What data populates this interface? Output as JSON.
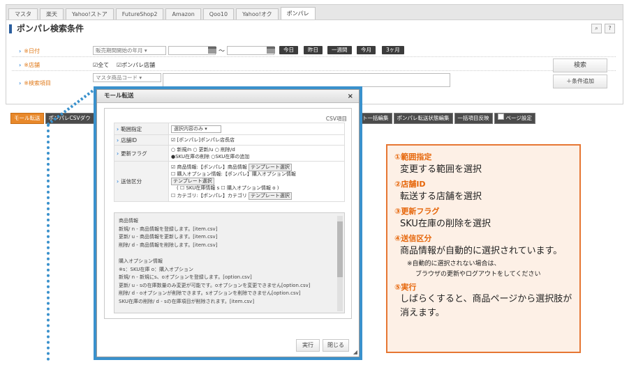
{
  "tabs": [
    "マスタ",
    "楽天",
    "Yahoo!ストア",
    "FutureShop2",
    "Amazon",
    "Qoo10",
    "Yahoo!オク",
    "ポンパレ"
  ],
  "panel_title": "ポンパレ検索条件",
  "search_icon": "search-icon",
  "help_label": "?",
  "rows": {
    "date_label": "※日付",
    "date_select": "販売期間開始の年月",
    "date_tilde": "～",
    "date_buttons": [
      "今日",
      "昨日",
      "一週間",
      "今月",
      "3ヶ月"
    ],
    "shop_label": "※店舗",
    "shop_all": "☑全て",
    "shop_pompare": "☑ポンパレ店舗",
    "item_label": "※検索項目",
    "item_select": "マスタ商品コード"
  },
  "search_button": "検索",
  "add_condition_button": "＋条件追加",
  "toolbar": {
    "mall": "モール転送",
    "csv": "ポンパレCSVダウ",
    "bulk1": "ト一括編集",
    "status": "ポンパレ転送状態編集",
    "reflect": "一括項目反映",
    "page_setting": "ページ設定"
  },
  "modal": {
    "title": "モール転送",
    "close": "×",
    "csv_label": "CSV項目",
    "range_label": "範囲指定",
    "range_value": "選択内容のみ",
    "shop_label": "店舗ID",
    "shop_value": "☑ [ポンパレ]ポンパレ店長店",
    "flag_label": "更新フラグ",
    "flag_line1": "○ 新規/n ○ 更新/u ○ 削除/d",
    "flag_line2": "●SKU在庫の削除 ○SKU在庫の追加",
    "send_label": "送信区分",
    "send_line1": "☑ 商品情報:【ポンパレ】商品情報",
    "send_line2": "☐ 購入オプション情報:【ポンパレ】購入オプション情報",
    "send_line3": "( ☐ SKU在庫情報 s ☐ 購入オプション情報 o )",
    "send_line4": "☐ カテゴリ:【ポンパレ】カテゴリ",
    "template": "テンプレート選択",
    "info_lines": [
      "商品情報",
      "新規/ n - 商品情報を登録します。[item.csv]",
      "更新/ u - 商品情報を更新します。[item.csv]",
      "削除/ d - 商品情報を削除します。[item.csv]",
      "",
      "購入オプション情報",
      "※s：SKU在庫 o：購入オプション",
      "新規/ n - 新規にs、oオプションを登録します。[option.csv]",
      "更新/ u - sの在庫数量のみ変更が可能です。oオプションを変更できません[option.csv]",
      "削除/ d - oオプションが削除できます。sオプションを削除できません[option.csv]",
      "SKU在庫の削除/ d - sの在庫項目が削除されます。[item.csv]"
    ],
    "run_button": "実行",
    "close_button": "閉じる"
  },
  "annotation": {
    "h1": "①範囲指定",
    "b1": "変更する範囲を選択",
    "h2": "②店舗ID",
    "b2": "転送する店舗を選択",
    "h3": "③更新フラグ",
    "b3": "SKU在庫の削除を選択",
    "h4": "④送信区分",
    "b4": "商品情報が自動的に選択されています。",
    "n1": "※自動的に選択されない場合は、",
    "n2": "ブラウザの更新やログアウトをしてください",
    "h5": "⑤実行",
    "b5a": "しばらくすると、商品ページから選択肢が",
    "b5b": "消えます。"
  }
}
